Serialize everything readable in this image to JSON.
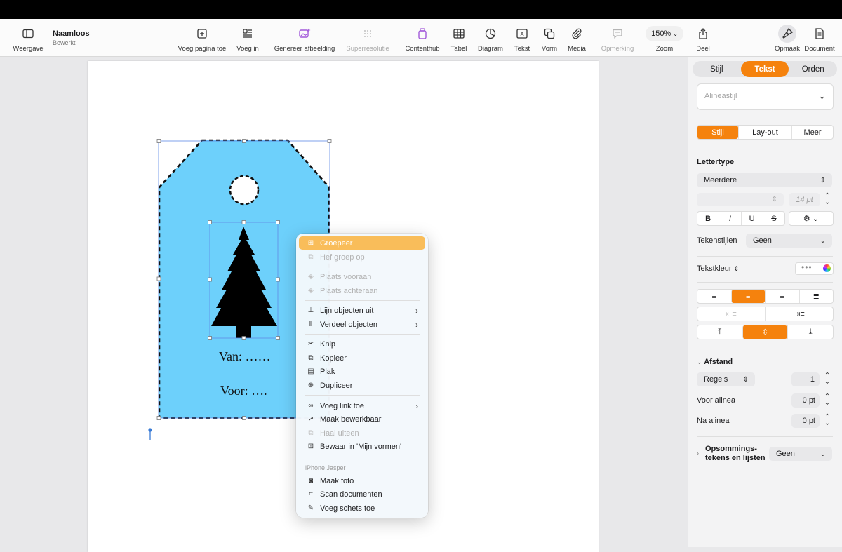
{
  "document": {
    "title": "Naamloos",
    "subtitle": "Bewerkt"
  },
  "toolbar": {
    "view": "Weergave",
    "add_page": "Voeg pagina toe",
    "insert": "Voeg in",
    "generate_image": "Genereer afbeelding",
    "super_resolution": "Superresolutie",
    "content_hub": "Contenthub",
    "table": "Tabel",
    "chart": "Diagram",
    "text": "Tekst",
    "shape": "Vorm",
    "media": "Media",
    "comment": "Opmerking",
    "zoom_value": "150%",
    "zoom": "Zoom",
    "share": "Deel",
    "format": "Opmaak",
    "document": "Document"
  },
  "tag": {
    "from_text": "Van: ……",
    "to_text": "Voor: …."
  },
  "context_menu": {
    "group": "Groepeer",
    "ungroup": "Hef groep op",
    "bring_front": "Plaats vooraan",
    "send_back": "Plaats achteraan",
    "align": "Lijn objecten uit",
    "distribute": "Verdeel objecten",
    "cut": "Knip",
    "copy": "Kopieer",
    "paste": "Plak",
    "duplicate": "Dupliceer",
    "add_link": "Voeg link toe",
    "make_editable": "Maak bewerkbaar",
    "break_apart": "Haal uiteen",
    "save_shapes": "Bewaar in 'Mijn vormen'",
    "section_device": "iPhone Jasper",
    "take_photo": "Maak foto",
    "scan_docs": "Scan documenten",
    "add_sketch": "Voeg schets toe"
  },
  "panel": {
    "tabs": [
      "Stijl",
      "Tekst",
      "Orden"
    ],
    "paragraph_style_placeholder": "Alineastijl",
    "subtabs": [
      "Stijl",
      "Lay-out",
      "Meer"
    ],
    "font_label": "Lettertype",
    "font_value": "Meerdere",
    "font_size": "14 pt",
    "bold": "B",
    "italic": "I",
    "underline": "U",
    "strike": "S",
    "char_styles_label": "Tekenstijlen",
    "char_styles_value": "Geen",
    "text_color_label": "Tekstkleur",
    "spacing_label": "Afstand",
    "spacing_mode": "Regels",
    "spacing_value": "1",
    "before_label": "Voor alinea",
    "before_value": "0 pt",
    "after_label": "Na alinea",
    "after_value": "0 pt",
    "bullets_label_1": "Opsommings-",
    "bullets_label_2": "tekens en lijsten",
    "bullets_value": "Geen"
  },
  "colors": {
    "accent": "#f5820d",
    "tag_fill": "#6dd0fb",
    "menu_highlight": "#f9bd5a"
  }
}
